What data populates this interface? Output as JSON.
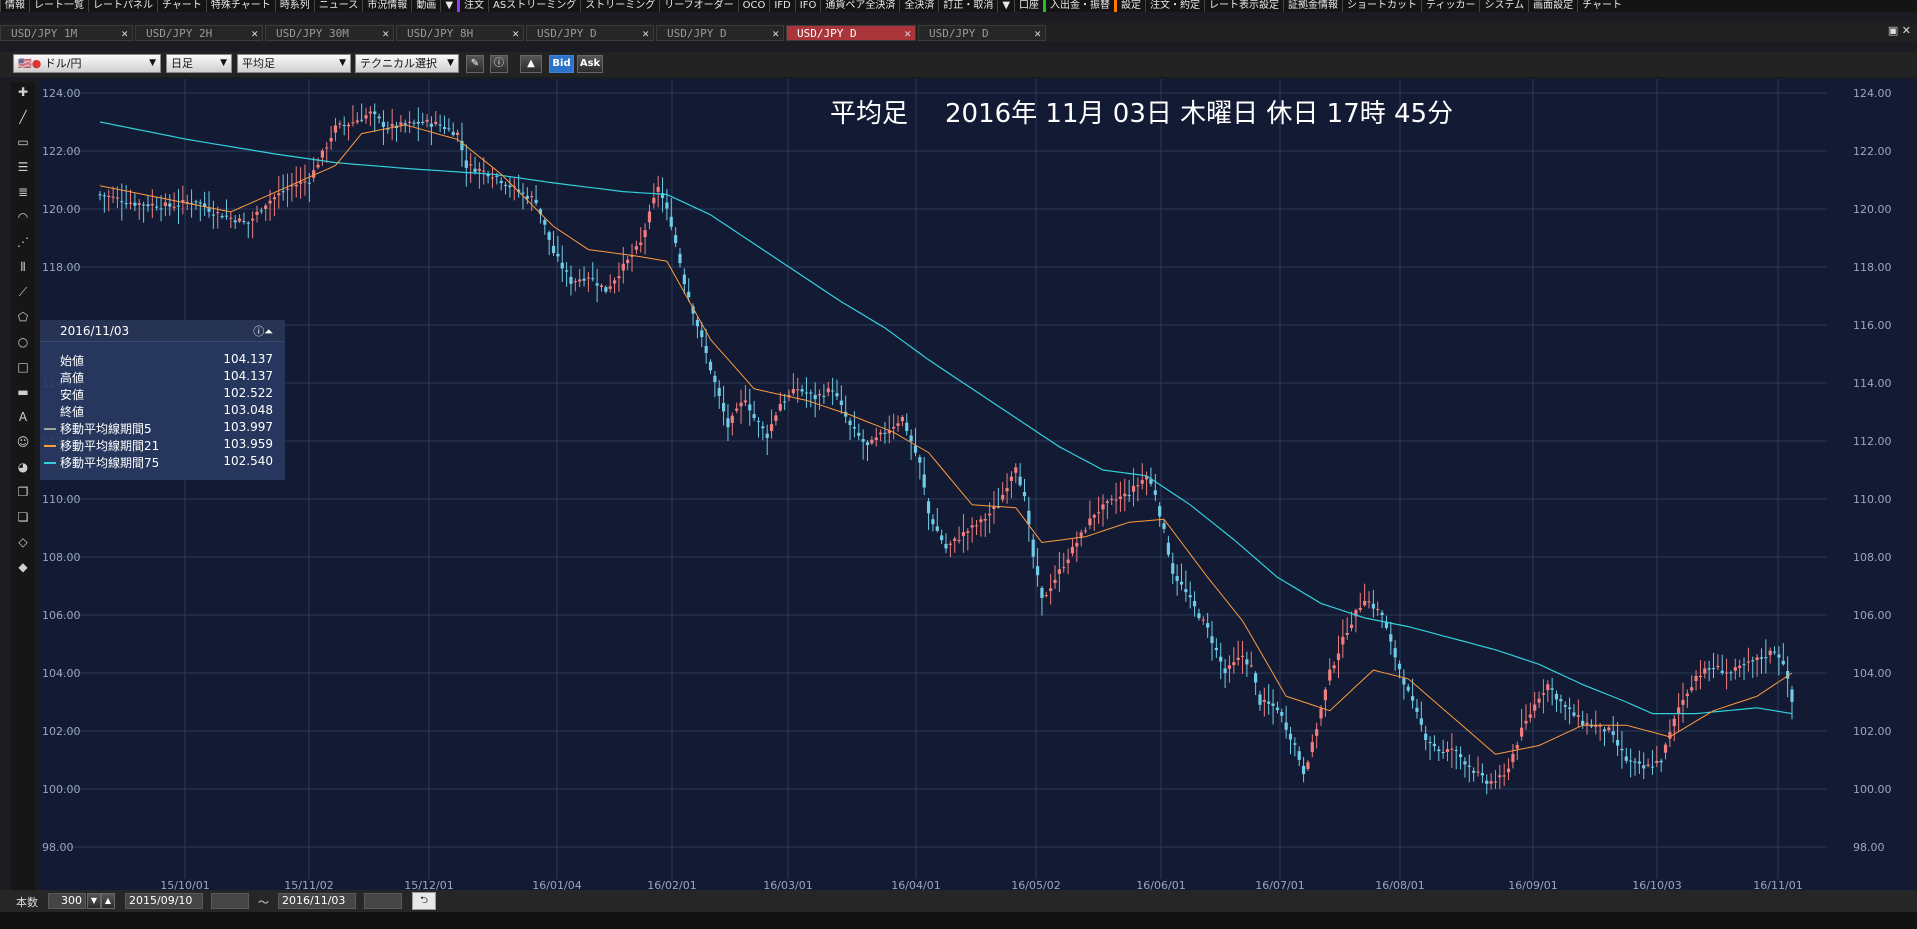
{
  "menubar": {
    "items": [
      "情報",
      "レート一覧",
      "レートパネル",
      "チャート",
      "特殊チャート",
      "時系列",
      "ニュース",
      "市況情報",
      "動画",
      "▼",
      "注文",
      "ASストリーミング",
      "ストリーミング",
      "リーフオーダー",
      "OCO",
      "IFD",
      "IFO",
      "通貨ペア全決済",
      "全決済",
      "訂正・取消",
      "▼",
      "口座",
      "入出金・振替",
      "設定",
      "注文・約定",
      "レート表示設定",
      "証拠金情報",
      "ショートカット",
      "ティッカー",
      "システム",
      "画面設定",
      "チャート"
    ]
  },
  "tabs": [
    {
      "label": "USD/JPY 1M",
      "active": false
    },
    {
      "label": "USD/JPY 2H",
      "active": false
    },
    {
      "label": "USD/JPY 30M",
      "active": false
    },
    {
      "label": "USD/JPY 8H",
      "active": false
    },
    {
      "label": "USD/JPY D",
      "active": false
    },
    {
      "label": "USD/JPY D",
      "active": false
    },
    {
      "label": "USD/JPY D",
      "active": true
    },
    {
      "label": "USD/JPY D",
      "active": false
    }
  ],
  "toolbar": {
    "pair": "ドル/円",
    "period": "日足",
    "chart_type": "平均足",
    "technical": "テクニカル選択",
    "bid_label": "Bid",
    "ask_label": "Ask"
  },
  "chart_header": {
    "type_label": "平均足",
    "datetime": "2016年 11月 03日 木曜日 休日 17時 45分"
  },
  "info": {
    "date": "2016/11/03",
    "rows": [
      {
        "label": "始値",
        "value": "104.137"
      },
      {
        "label": "高値",
        "value": "104.137"
      },
      {
        "label": "安値",
        "value": "102.522"
      },
      {
        "label": "終値",
        "value": "103.048"
      },
      {
        "label": "移動平均線期間5",
        "value": "103.997",
        "color": "#a0a0a0"
      },
      {
        "label": "移動平均線期間21",
        "value": "103.959",
        "color": "#ff9a3c"
      },
      {
        "label": "移動平均線期間75",
        "value": "102.540",
        "color": "#33d0dc"
      }
    ]
  },
  "bottom": {
    "count_label": "本数",
    "count": "300",
    "start_date": "2015/09/10",
    "tilde": "〜",
    "end_date": "2016/11/03"
  },
  "chart_data": {
    "type": "candlestick",
    "title": "平均足",
    "ylim": [
      97,
      124.5
    ],
    "yticks": [
      "124.00",
      "122.00",
      "120.00",
      "118.00",
      "116.00",
      "114.00",
      "112.00",
      "110.00",
      "108.00",
      "106.00",
      "104.00",
      "102.00",
      "100.00",
      "98.00"
    ],
    "xticks": [
      "15/10/01",
      "15/11/02",
      "15/12/01",
      "16/01/04",
      "16/02/01",
      "16/03/01",
      "16/04/01",
      "16/05/02",
      "16/06/01",
      "16/07/01",
      "16/08/01",
      "16/09/01",
      "16/10/03",
      "16/11/01"
    ],
    "colors": {
      "up": "#f07e7e",
      "down": "#6fcbe6",
      "ma5": "#a0a0a0",
      "ma21": "#ff9a3c",
      "ma75": "#33d0dc",
      "bg": "#121b33",
      "grid": "#2c3a5a"
    },
    "close_path": [
      [
        0,
        120.5
      ],
      [
        8,
        120.2
      ],
      [
        16,
        120.1
      ],
      [
        22,
        120.3
      ],
      [
        26,
        119.9
      ],
      [
        34,
        119.5
      ],
      [
        38,
        120.2
      ],
      [
        44,
        120.8
      ],
      [
        48,
        121.0
      ],
      [
        54,
        122.8
      ],
      [
        58,
        123.0
      ],
      [
        62,
        123.3
      ],
      [
        66,
        122.8
      ],
      [
        74,
        123.0
      ],
      [
        78,
        122.9
      ],
      [
        82,
        122.6
      ],
      [
        84,
        121.5
      ],
      [
        90,
        121.2
      ],
      [
        96,
        120.6
      ],
      [
        100,
        120.3
      ],
      [
        104,
        118.5
      ],
      [
        108,
        117.5
      ],
      [
        112,
        117.7
      ],
      [
        116,
        117.2
      ],
      [
        120,
        118.0
      ],
      [
        124,
        118.8
      ],
      [
        128,
        120.8
      ],
      [
        131,
        119.5
      ],
      [
        134,
        117.5
      ],
      [
        138,
        115.5
      ],
      [
        142,
        113.5
      ],
      [
        144,
        112.5
      ],
      [
        148,
        113.5
      ],
      [
        150,
        112.8
      ],
      [
        153,
        112.2
      ],
      [
        156,
        113.3
      ],
      [
        160,
        113.8
      ],
      [
        164,
        113.5
      ],
      [
        168,
        113.8
      ],
      [
        172,
        112.5
      ],
      [
        176,
        111.8
      ],
      [
        180,
        112.3
      ],
      [
        184,
        112.8
      ],
      [
        186,
        112.0
      ],
      [
        188,
        111.2
      ],
      [
        190,
        109.5
      ],
      [
        194,
        108.3
      ],
      [
        198,
        108.8
      ],
      [
        202,
        109.2
      ],
      [
        206,
        109.8
      ],
      [
        210,
        111.2
      ],
      [
        212,
        110.0
      ],
      [
        214,
        108.0
      ],
      [
        216,
        106.5
      ],
      [
        220,
        107.5
      ],
      [
        224,
        108.5
      ],
      [
        228,
        109.5
      ],
      [
        232,
        109.9
      ],
      [
        236,
        110.2
      ],
      [
        240,
        110.8
      ],
      [
        242,
        110.2
      ],
      [
        246,
        107.5
      ],
      [
        250,
        106.5
      ],
      [
        254,
        105.5
      ],
      [
        258,
        104.0
      ],
      [
        262,
        104.6
      ],
      [
        264,
        104.2
      ],
      [
        266,
        103.0
      ],
      [
        270,
        102.8
      ],
      [
        274,
        101.5
      ],
      [
        276,
        100.6
      ],
      [
        278,
        101.5
      ],
      [
        282,
        104.0
      ],
      [
        286,
        105.5
      ],
      [
        290,
        106.6
      ],
      [
        294,
        106.0
      ],
      [
        296,
        105.0
      ],
      [
        300,
        103.3
      ],
      [
        304,
        101.8
      ],
      [
        308,
        101.2
      ],
      [
        310,
        101.4
      ],
      [
        314,
        100.8
      ],
      [
        318,
        100.2
      ],
      [
        322,
        100.4
      ],
      [
        326,
        102.0
      ],
      [
        330,
        103.2
      ],
      [
        332,
        103.6
      ],
      [
        336,
        102.8
      ],
      [
        340,
        102.3
      ],
      [
        346,
        102.0
      ],
      [
        350,
        101.0
      ],
      [
        354,
        100.7
      ],
      [
        358,
        101.0
      ],
      [
        362,
        102.8
      ],
      [
        366,
        103.9
      ],
      [
        370,
        104.2
      ],
      [
        374,
        104.0
      ],
      [
        378,
        104.3
      ],
      [
        382,
        104.6
      ],
      [
        384,
        104.8
      ],
      [
        386,
        104.4
      ],
      [
        388,
        103.0
      ]
    ],
    "ma21_path": [
      [
        0,
        120.8
      ],
      [
        30,
        119.9
      ],
      [
        54,
        121.5
      ],
      [
        60,
        122.6
      ],
      [
        70,
        122.9
      ],
      [
        82,
        122.4
      ],
      [
        92,
        121.2
      ],
      [
        104,
        119.4
      ],
      [
        112,
        118.6
      ],
      [
        122,
        118.4
      ],
      [
        130,
        118.2
      ],
      [
        140,
        115.5
      ],
      [
        150,
        113.8
      ],
      [
        162,
        113.4
      ],
      [
        172,
        112.9
      ],
      [
        182,
        112.3
      ],
      [
        190,
        111.6
      ],
      [
        200,
        109.8
      ],
      [
        210,
        109.7
      ],
      [
        216,
        108.5
      ],
      [
        226,
        108.7
      ],
      [
        236,
        109.2
      ],
      [
        244,
        109.3
      ],
      [
        254,
        107.3
      ],
      [
        262,
        105.8
      ],
      [
        272,
        103.2
      ],
      [
        282,
        102.7
      ],
      [
        292,
        104.1
      ],
      [
        300,
        103.8
      ],
      [
        310,
        102.5
      ],
      [
        320,
        101.2
      ],
      [
        330,
        101.5
      ],
      [
        340,
        102.2
      ],
      [
        350,
        102.2
      ],
      [
        360,
        101.8
      ],
      [
        370,
        102.7
      ],
      [
        380,
        103.2
      ],
      [
        388,
        104.0
      ]
    ],
    "ma75_path": [
      [
        0,
        123.0
      ],
      [
        20,
        122.4
      ],
      [
        40,
        121.9
      ],
      [
        54,
        121.6
      ],
      [
        70,
        121.4
      ],
      [
        90,
        121.2
      ],
      [
        104,
        120.9
      ],
      [
        120,
        120.6
      ],
      [
        130,
        120.5
      ],
      [
        140,
        119.8
      ],
      [
        150,
        118.8
      ],
      [
        160,
        117.8
      ],
      [
        170,
        116.8
      ],
      [
        180,
        115.9
      ],
      [
        190,
        114.8
      ],
      [
        200,
        113.8
      ],
      [
        210,
        112.8
      ],
      [
        220,
        111.8
      ],
      [
        230,
        111.0
      ],
      [
        240,
        110.8
      ],
      [
        250,
        109.8
      ],
      [
        260,
        108.6
      ],
      [
        270,
        107.3
      ],
      [
        280,
        106.4
      ],
      [
        290,
        105.9
      ],
      [
        300,
        105.6
      ],
      [
        310,
        105.2
      ],
      [
        320,
        104.8
      ],
      [
        330,
        104.3
      ],
      [
        340,
        103.6
      ],
      [
        350,
        103.0
      ],
      [
        356,
        102.6
      ],
      [
        366,
        102.6
      ],
      [
        380,
        102.8
      ],
      [
        388,
        102.6
      ]
    ]
  }
}
